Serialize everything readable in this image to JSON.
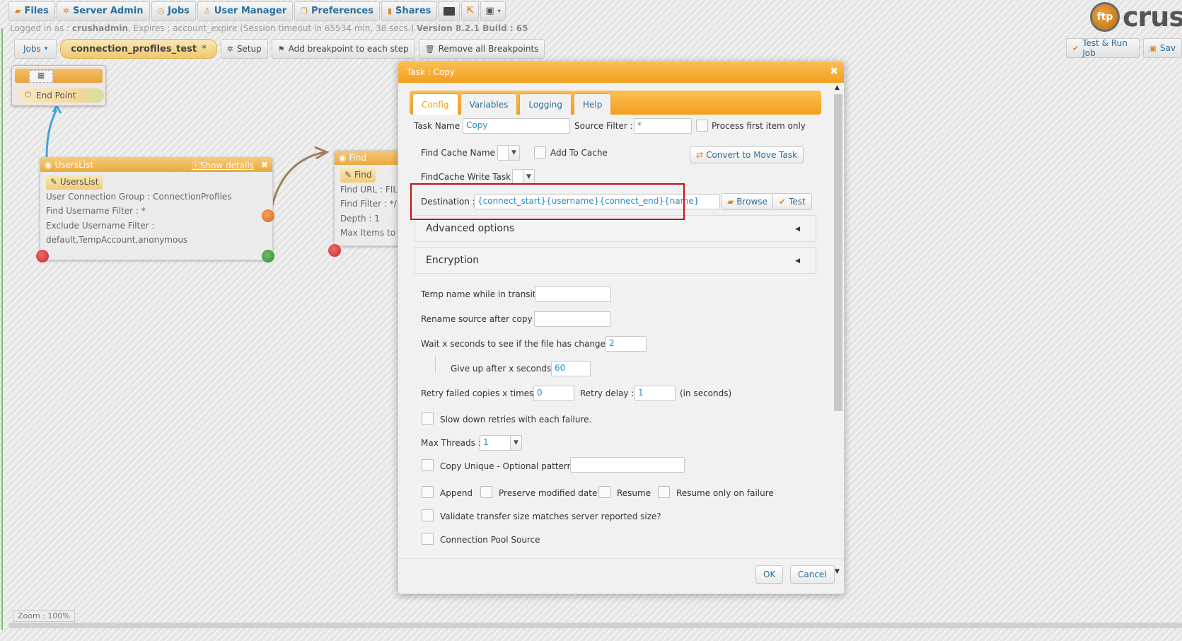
{
  "nav": {
    "items": [
      {
        "label": "Files",
        "icon": "folder-icon"
      },
      {
        "label": "Server Admin",
        "icon": "gear-icon"
      },
      {
        "label": "Jobs",
        "icon": "clock-icon"
      },
      {
        "label": "User Manager",
        "icon": "user-icon"
      },
      {
        "label": "Preferences",
        "icon": "preferences-icon"
      },
      {
        "label": "Shares",
        "icon": "shares-icon"
      }
    ],
    "logo_text": "crush"
  },
  "session": {
    "prefix": "Logged in as : ",
    "user": "crushadmin",
    "rest": ", Expires : account_expire  (Session timeout in 65534 min, 38 secs.)  ",
    "version": "Version 8.2.1 Build : 65"
  },
  "toolbar": {
    "jobs_label": "Jobs",
    "job_name": "connection_profiles_test",
    "job_dirty_mark": "*",
    "setup_label": "Setup",
    "add_breakpoint_label": "Add breakpoint to each step",
    "remove_breakpoints_label": "Remove all Breakpoints",
    "test_run_label": "Test & Run Job",
    "save_label": "Sav"
  },
  "canvas": {
    "endpoint": {
      "label": "End Point"
    },
    "userslist": {
      "title": "UsersList",
      "show_details": "Show details",
      "pill": "UsersList",
      "lines": [
        "User Connection Group : ConnectionProfiles",
        "Find Username Filter : *",
        "Exclude Username Filter :",
        "default,TempAccount,anonymous"
      ]
    },
    "find": {
      "title": "Find",
      "pill": "Find",
      "lines": [
        "Find URL : FILE",
        "Find Filter : */",
        "Depth : 1",
        "Max Items to F"
      ]
    },
    "zoom": "Zoom : 100%"
  },
  "dialog": {
    "title": "Task : Copy",
    "tabs": [
      "Config",
      "Variables",
      "Logging",
      "Help"
    ],
    "task_name_label": "Task Name :",
    "task_name_value": "Copy",
    "source_filter_label": "Source Filter :",
    "source_filter_value": "*",
    "process_first_label": "Process first item only",
    "find_cache_label": "Find Cache Name :",
    "add_to_cache_label": "Add To Cache",
    "convert_label": "Convert to Move Task",
    "findcache_write_label": "FindCache Write Task :",
    "destination_label": "Destination :",
    "destination_value": "{connect_start}{username}{connect_end}{name}",
    "browse_label": "Browse",
    "test_label": "Test",
    "advanced_label": "Advanced options",
    "encryption_label": "Encryption",
    "temp_name_label": "Temp name while in transit :",
    "rename_source_label": "Rename source after copy :",
    "wait_label": "Wait x seconds to see if the file has changed :",
    "wait_value": "2",
    "giveup_label": "Give up after x seconds :",
    "giveup_value": "60",
    "retry_label": "Retry failed copies x times :",
    "retry_value": "0",
    "retry_delay_label": "Retry delay :",
    "retry_delay_value": "1",
    "in_seconds": "(in seconds)",
    "slow_down_label": "Slow down retries with each failure.",
    "max_threads_label": "Max Threads :",
    "max_threads_value": "1",
    "copy_unique_label": "Copy Unique - Optional pattern:",
    "append_label": "Append",
    "preserve_label": "Preserve modified date",
    "resume_label": "Resume",
    "resume_failure_label": "Resume only on failure",
    "validate_label": "Validate transfer size matches server reported size?",
    "pool_label": "Connection Pool Source",
    "ok_label": "OK",
    "cancel_label": "Cancel"
  },
  "colors": {
    "accent": "#f39f1d",
    "link": "#2a6f9c",
    "highlight": "#cc1010"
  }
}
